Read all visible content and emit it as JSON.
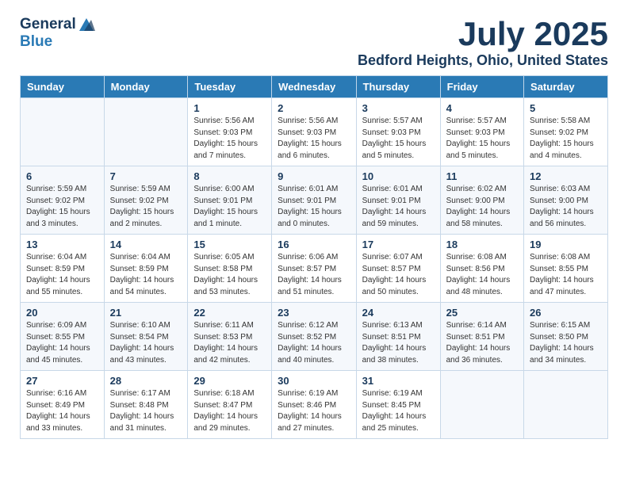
{
  "logo": {
    "general": "General",
    "blue": "Blue"
  },
  "title": "July 2025",
  "subtitle": "Bedford Heights, Ohio, United States",
  "weekdays": [
    "Sunday",
    "Monday",
    "Tuesday",
    "Wednesday",
    "Thursday",
    "Friday",
    "Saturday"
  ],
  "weeks": [
    [
      {
        "day": "",
        "info": ""
      },
      {
        "day": "",
        "info": ""
      },
      {
        "day": "1",
        "info": "Sunrise: 5:56 AM\nSunset: 9:03 PM\nDaylight: 15 hours and 7 minutes."
      },
      {
        "day": "2",
        "info": "Sunrise: 5:56 AM\nSunset: 9:03 PM\nDaylight: 15 hours and 6 minutes."
      },
      {
        "day": "3",
        "info": "Sunrise: 5:57 AM\nSunset: 9:03 PM\nDaylight: 15 hours and 5 minutes."
      },
      {
        "day": "4",
        "info": "Sunrise: 5:57 AM\nSunset: 9:03 PM\nDaylight: 15 hours and 5 minutes."
      },
      {
        "day": "5",
        "info": "Sunrise: 5:58 AM\nSunset: 9:02 PM\nDaylight: 15 hours and 4 minutes."
      }
    ],
    [
      {
        "day": "6",
        "info": "Sunrise: 5:59 AM\nSunset: 9:02 PM\nDaylight: 15 hours and 3 minutes."
      },
      {
        "day": "7",
        "info": "Sunrise: 5:59 AM\nSunset: 9:02 PM\nDaylight: 15 hours and 2 minutes."
      },
      {
        "day": "8",
        "info": "Sunrise: 6:00 AM\nSunset: 9:01 PM\nDaylight: 15 hours and 1 minute."
      },
      {
        "day": "9",
        "info": "Sunrise: 6:01 AM\nSunset: 9:01 PM\nDaylight: 15 hours and 0 minutes."
      },
      {
        "day": "10",
        "info": "Sunrise: 6:01 AM\nSunset: 9:01 PM\nDaylight: 14 hours and 59 minutes."
      },
      {
        "day": "11",
        "info": "Sunrise: 6:02 AM\nSunset: 9:00 PM\nDaylight: 14 hours and 58 minutes."
      },
      {
        "day": "12",
        "info": "Sunrise: 6:03 AM\nSunset: 9:00 PM\nDaylight: 14 hours and 56 minutes."
      }
    ],
    [
      {
        "day": "13",
        "info": "Sunrise: 6:04 AM\nSunset: 8:59 PM\nDaylight: 14 hours and 55 minutes."
      },
      {
        "day": "14",
        "info": "Sunrise: 6:04 AM\nSunset: 8:59 PM\nDaylight: 14 hours and 54 minutes."
      },
      {
        "day": "15",
        "info": "Sunrise: 6:05 AM\nSunset: 8:58 PM\nDaylight: 14 hours and 53 minutes."
      },
      {
        "day": "16",
        "info": "Sunrise: 6:06 AM\nSunset: 8:57 PM\nDaylight: 14 hours and 51 minutes."
      },
      {
        "day": "17",
        "info": "Sunrise: 6:07 AM\nSunset: 8:57 PM\nDaylight: 14 hours and 50 minutes."
      },
      {
        "day": "18",
        "info": "Sunrise: 6:08 AM\nSunset: 8:56 PM\nDaylight: 14 hours and 48 minutes."
      },
      {
        "day": "19",
        "info": "Sunrise: 6:08 AM\nSunset: 8:55 PM\nDaylight: 14 hours and 47 minutes."
      }
    ],
    [
      {
        "day": "20",
        "info": "Sunrise: 6:09 AM\nSunset: 8:55 PM\nDaylight: 14 hours and 45 minutes."
      },
      {
        "day": "21",
        "info": "Sunrise: 6:10 AM\nSunset: 8:54 PM\nDaylight: 14 hours and 43 minutes."
      },
      {
        "day": "22",
        "info": "Sunrise: 6:11 AM\nSunset: 8:53 PM\nDaylight: 14 hours and 42 minutes."
      },
      {
        "day": "23",
        "info": "Sunrise: 6:12 AM\nSunset: 8:52 PM\nDaylight: 14 hours and 40 minutes."
      },
      {
        "day": "24",
        "info": "Sunrise: 6:13 AM\nSunset: 8:51 PM\nDaylight: 14 hours and 38 minutes."
      },
      {
        "day": "25",
        "info": "Sunrise: 6:14 AM\nSunset: 8:51 PM\nDaylight: 14 hours and 36 minutes."
      },
      {
        "day": "26",
        "info": "Sunrise: 6:15 AM\nSunset: 8:50 PM\nDaylight: 14 hours and 34 minutes."
      }
    ],
    [
      {
        "day": "27",
        "info": "Sunrise: 6:16 AM\nSunset: 8:49 PM\nDaylight: 14 hours and 33 minutes."
      },
      {
        "day": "28",
        "info": "Sunrise: 6:17 AM\nSunset: 8:48 PM\nDaylight: 14 hours and 31 minutes."
      },
      {
        "day": "29",
        "info": "Sunrise: 6:18 AM\nSunset: 8:47 PM\nDaylight: 14 hours and 29 minutes."
      },
      {
        "day": "30",
        "info": "Sunrise: 6:19 AM\nSunset: 8:46 PM\nDaylight: 14 hours and 27 minutes."
      },
      {
        "day": "31",
        "info": "Sunrise: 6:19 AM\nSunset: 8:45 PM\nDaylight: 14 hours and 25 minutes."
      },
      {
        "day": "",
        "info": ""
      },
      {
        "day": "",
        "info": ""
      }
    ]
  ]
}
